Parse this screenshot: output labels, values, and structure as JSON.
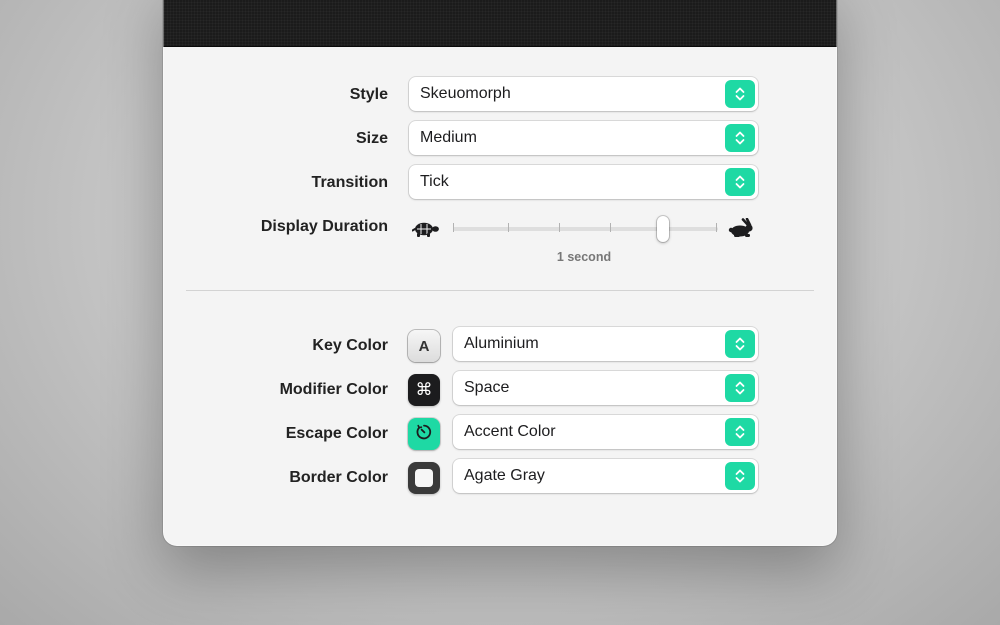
{
  "appearance": {
    "style": {
      "label": "Style",
      "value": "Skeuomorph"
    },
    "size": {
      "label": "Size",
      "value": "Medium"
    },
    "transition": {
      "label": "Transition",
      "value": "Tick"
    },
    "display_duration": {
      "label": "Display Duration",
      "value_text": "1 second",
      "slider_fraction": 0.8,
      "min_icon": "turtle-icon",
      "max_icon": "rabbit-icon"
    }
  },
  "colors": {
    "key": {
      "label": "Key Color",
      "value": "Aluminium",
      "swatch_glyph": "A",
      "swatch_bg": "#ececec"
    },
    "modifier": {
      "label": "Modifier Color",
      "value": "Space",
      "swatch_glyph": "⌘",
      "swatch_bg": "#1c1c1e"
    },
    "escape": {
      "label": "Escape Color",
      "value": "Accent Color",
      "swatch_icon": "escape-timer-icon",
      "swatch_bg": "#1ed9a4"
    },
    "border": {
      "label": "Border Color",
      "value": "Agate Gray",
      "swatch_bg": "#3a3a3a"
    }
  },
  "accent_color": "#1ed9a4",
  "stepper_icon": "chevron-up-down-icon"
}
